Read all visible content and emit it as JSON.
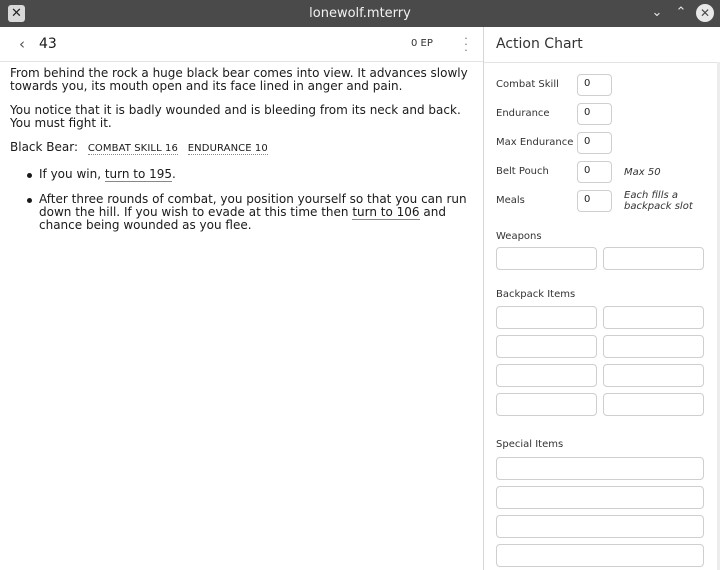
{
  "window": {
    "title": "lonewolf.mterry"
  },
  "header": {
    "section": "43",
    "ep": "0 EP"
  },
  "story": {
    "p1": "From behind the rock a huge black bear comes into view. It advances slowly towards you, its mouth open and its face lined in anger and pain.",
    "p2": "You notice that it is badly wounded and is bleeding from its neck and back. You must fight it.",
    "enemy_name": "Black Bear:",
    "enemy_cs": "COMBAT SKILL 16",
    "enemy_end": "ENDURANCE 10",
    "b1_pre": "If you win, ",
    "b1_link": "turn to 195",
    "b1_post": ".",
    "b2_pre": "After three rounds of combat, you position yourself so that you can run down the hill. If you wish to evade at this time then ",
    "b2_link": "turn to 106",
    "b2_post": " and chance being wounded as you flee."
  },
  "action_chart": {
    "title": "Action Chart",
    "combat_skill": {
      "label": "Combat Skill",
      "value": "0"
    },
    "endurance": {
      "label": "Endurance",
      "value": "0"
    },
    "max_endurance": {
      "label": "Max Endurance",
      "value": "0"
    },
    "belt_pouch": {
      "label": "Belt Pouch",
      "value": "0",
      "note": "Max 50"
    },
    "meals": {
      "label": "Meals",
      "value": "0",
      "note": "Each fills a backpack slot"
    },
    "weapons_label": "Weapons",
    "backpack_label": "Backpack Items",
    "special_label": "Special Items"
  }
}
